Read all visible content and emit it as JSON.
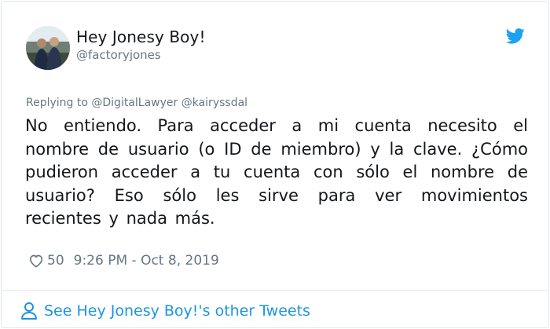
{
  "user": {
    "display_name": "Hey Jonesy Boy!",
    "handle": "@factoryjones"
  },
  "icons": {
    "brand": "twitter-bird-icon",
    "like": "heart-icon",
    "profile": "person-icon"
  },
  "colors": {
    "brand_blue": "#1da1f2",
    "link_blue": "#1b95e0",
    "muted": "#657786",
    "text": "#14171a"
  },
  "reply": {
    "prefix": "Replying to",
    "mentions": "@DigitalLawyer @kairyssdal"
  },
  "tweet": {
    "text": "No entiendo. Para acceder a mi cuenta necesito el nombre de usuario (o ID de  miembro) y la clave. ¿Cómo pudieron acceder a tu cuenta con sólo el nombre de usuario? Eso sólo les sirve para ver movimientos recientes y nada más."
  },
  "meta": {
    "likes": "50",
    "timestamp": "9:26 PM - Oct 8, 2019"
  },
  "footer": {
    "link_label": "See Hey Jonesy Boy!'s other Tweets"
  }
}
